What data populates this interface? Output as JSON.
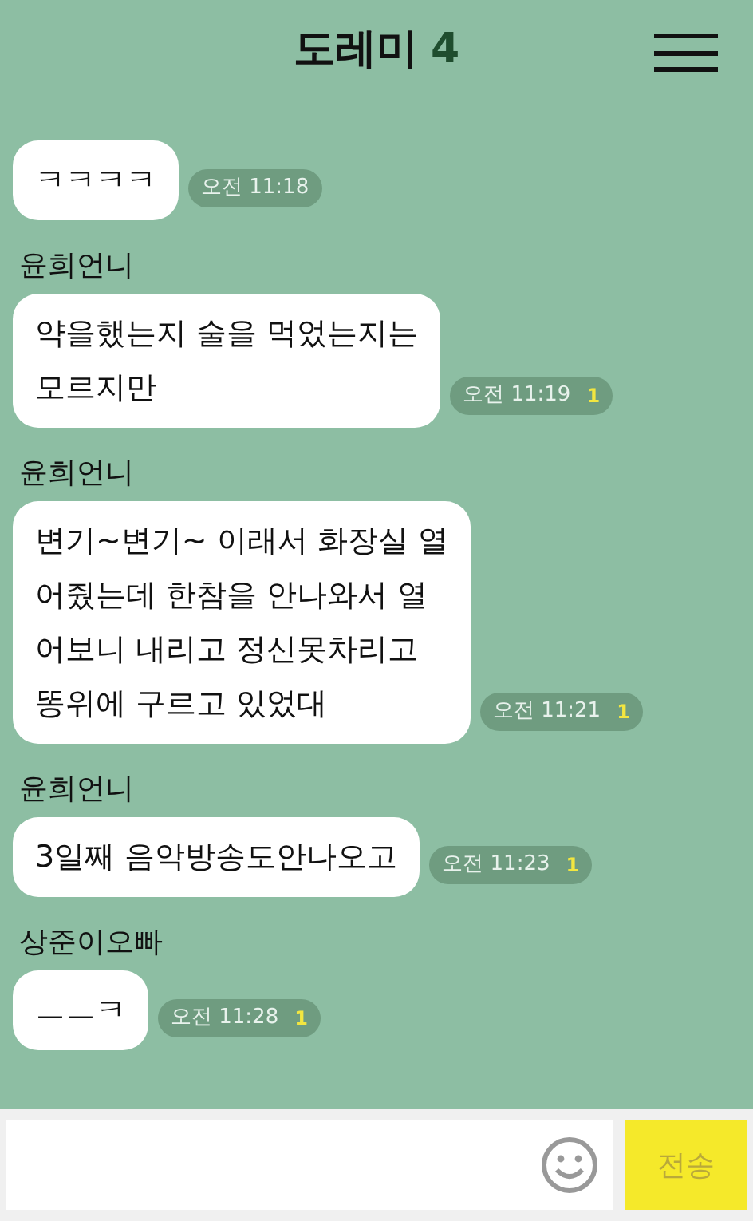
{
  "header": {
    "title": "도레미",
    "member_count": "4"
  },
  "messages": [
    {
      "text": "ㅋㅋㅋㅋ",
      "time": "오전 11:18"
    },
    {
      "sender": "윤희언니",
      "text": "약을했는지 술을 먹었는지는\n모르지만",
      "time": "오전 11:19",
      "unread": "1"
    },
    {
      "sender": "윤희언니",
      "text": "변기~변기~ 이래서 화장실 열\n어줬는데 한참을 안나와서 열\n어보니 내리고 정신못차리고\n똥위에 구르고 있었대",
      "time": "오전 11:21",
      "unread": "1"
    },
    {
      "sender": "윤희언니",
      "text": "3일째 음악방송도안나오고",
      "time": "오전 11:23",
      "unread": "1"
    },
    {
      "sender": "상준이오빠",
      "text": "ㅡㅡㅋ",
      "time": "오전 11:28",
      "unread": "1"
    }
  ],
  "composer": {
    "send_label": "전송"
  }
}
